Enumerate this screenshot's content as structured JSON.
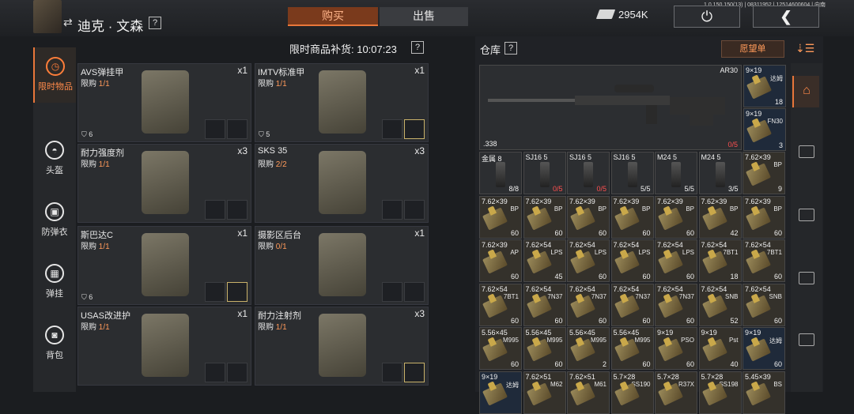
{
  "header": {
    "player_name": "迪克 · 文森",
    "help": "?",
    "tab_buy": "购买",
    "tab_sell": "出售",
    "money": "2954K",
    "version": "1.0.150.150(13) | 08311952 | 12514600604 | 向南"
  },
  "nav": [
    {
      "label": "限时物品",
      "icon": "clock-icon"
    },
    {
      "label": "头盔",
      "icon": "helmet-icon"
    },
    {
      "label": "防弹衣",
      "icon": "vest-icon"
    },
    {
      "label": "弹挂",
      "icon": "rig-icon"
    },
    {
      "label": "背包",
      "icon": "backpack-icon"
    }
  ],
  "shop": {
    "restock_label": "限时商品补货: 10:07:23",
    "limit_prefix": "限购",
    "items": [
      {
        "name": "AVS弹挂甲",
        "limit": "1/1",
        "qty": "x1",
        "durability": "6"
      },
      {
        "name": "IMTV标准甲",
        "limit": "1/1",
        "qty": "x1",
        "durability": "5"
      },
      {
        "name": "耐力强度剂",
        "limit": "1/1",
        "qty": "x3",
        "durability": ""
      },
      {
        "name": "SKS 35",
        "limit": "2/2",
        "qty": "x3",
        "durability": ""
      },
      {
        "name": "斯巴达C",
        "limit": "1/1",
        "qty": "x1",
        "durability": "6"
      },
      {
        "name": "摄影区后台",
        "limit": "0/1",
        "qty": "x1",
        "durability": ""
      },
      {
        "name": "USAS改进护",
        "limit": "1/1",
        "qty": "x1",
        "durability": ""
      },
      {
        "name": "耐力注射剂",
        "limit": "1/1",
        "qty": "x3",
        "durability": ""
      }
    ]
  },
  "warehouse": {
    "title": "仓库",
    "wishlist": "愿望单",
    "big_item": {
      "name": "AR30",
      "caliber": ".338",
      "count": "0/5"
    },
    "side_cells": [
      {
        "name": "9×19",
        "sub": "达姆",
        "count": "18"
      },
      {
        "name": "9×19",
        "sub": "FN30",
        "count": "3"
      }
    ],
    "rows": [
      [
        {
          "name": "金属 8",
          "sub": "",
          "count": "8/8",
          "kind": "mag"
        },
        {
          "name": "SJ16 5",
          "sub": "",
          "count": "0/5",
          "kind": "mag",
          "red": true
        },
        {
          "name": "SJ16 5",
          "sub": "",
          "count": "0/5",
          "kind": "mag",
          "red": true
        },
        {
          "name": "SJ16 5",
          "sub": "",
          "count": "5/5",
          "kind": "mag"
        },
        {
          "name": "M24 5",
          "sub": "",
          "count": "5/5",
          "kind": "mag"
        },
        {
          "name": "M24 5",
          "sub": "",
          "count": "3/5",
          "kind": "mag"
        },
        {
          "name": "7.62×39",
          "sub": "BP",
          "count": "9",
          "kind": "ammo"
        }
      ],
      [
        {
          "name": "7.62×39",
          "sub": "BP",
          "count": "60",
          "kind": "ammo"
        },
        {
          "name": "7.62×39",
          "sub": "BP",
          "count": "60",
          "kind": "ammo"
        },
        {
          "name": "7.62×39",
          "sub": "BP",
          "count": "60",
          "kind": "ammo"
        },
        {
          "name": "7.62×39",
          "sub": "BP",
          "count": "60",
          "kind": "ammo"
        },
        {
          "name": "7.62×39",
          "sub": "BP",
          "count": "60",
          "kind": "ammo"
        },
        {
          "name": "7.62×39",
          "sub": "BP",
          "count": "42",
          "kind": "ammo"
        },
        {
          "name": "7.62×39",
          "sub": "BP",
          "count": "60",
          "kind": "ammo"
        }
      ],
      [
        {
          "name": "7.62×39",
          "sub": "AP",
          "count": "60",
          "kind": "ammo"
        },
        {
          "name": "7.62×54",
          "sub": "LPS",
          "count": "45",
          "kind": "ammo"
        },
        {
          "name": "7.62×54",
          "sub": "LPS",
          "count": "60",
          "kind": "ammo"
        },
        {
          "name": "7.62×54",
          "sub": "LPS",
          "count": "60",
          "kind": "ammo"
        },
        {
          "name": "7.62×54",
          "sub": "LPS",
          "count": "60",
          "kind": "ammo"
        },
        {
          "name": "7.62×54",
          "sub": "7BT1",
          "count": "18",
          "kind": "ammo"
        },
        {
          "name": "7.62×54",
          "sub": "7BT1",
          "count": "60",
          "kind": "ammo"
        }
      ],
      [
        {
          "name": "7.62×54",
          "sub": "7BT1",
          "count": "60",
          "kind": "ammo"
        },
        {
          "name": "7.62×54",
          "sub": "7N37",
          "count": "60",
          "kind": "ammo"
        },
        {
          "name": "7.62×54",
          "sub": "7N37",
          "count": "60",
          "kind": "ammo"
        },
        {
          "name": "7.62×54",
          "sub": "7N37",
          "count": "60",
          "kind": "ammo"
        },
        {
          "name": "7.62×54",
          "sub": "7N37",
          "count": "60",
          "kind": "ammo"
        },
        {
          "name": "7.62×54",
          "sub": "SNB",
          "count": "52",
          "kind": "ammo"
        },
        {
          "name": "7.62×54",
          "sub": "SNB",
          "count": "60",
          "kind": "ammo"
        }
      ],
      [
        {
          "name": "5.56×45",
          "sub": "M995",
          "count": "60",
          "kind": "ammo"
        },
        {
          "name": "5.56×45",
          "sub": "M995",
          "count": "60",
          "kind": "ammo"
        },
        {
          "name": "5.56×45",
          "sub": "M995",
          "count": "2",
          "kind": "ammo"
        },
        {
          "name": "5.56×45",
          "sub": "M995",
          "count": "60",
          "kind": "ammo"
        },
        {
          "name": "9×19",
          "sub": "PSO",
          "count": "60",
          "kind": "ammo"
        },
        {
          "name": "9×19",
          "sub": "Pst",
          "count": "40",
          "kind": "ammo"
        },
        {
          "name": "9×19",
          "sub": "达姆",
          "count": "60",
          "kind": "ammo",
          "blue": true
        }
      ],
      [
        {
          "name": "9×19",
          "sub": "达姆",
          "count": "",
          "kind": "ammo",
          "blue": true
        },
        {
          "name": "7.62×51",
          "sub": "M62",
          "count": "",
          "kind": "ammo"
        },
        {
          "name": "7.62×51",
          "sub": "M61",
          "count": "",
          "kind": "ammo"
        },
        {
          "name": "5.7×28",
          "sub": "SS190",
          "count": "",
          "kind": "ammo"
        },
        {
          "name": "5.7×28",
          "sub": "R37X",
          "count": "",
          "kind": "ammo"
        },
        {
          "name": "5.7×28",
          "sub": "SS198",
          "count": "",
          "kind": "ammo"
        },
        {
          "name": "5.45×39",
          "sub": "BS",
          "count": "",
          "kind": "ammo"
        }
      ]
    ]
  }
}
